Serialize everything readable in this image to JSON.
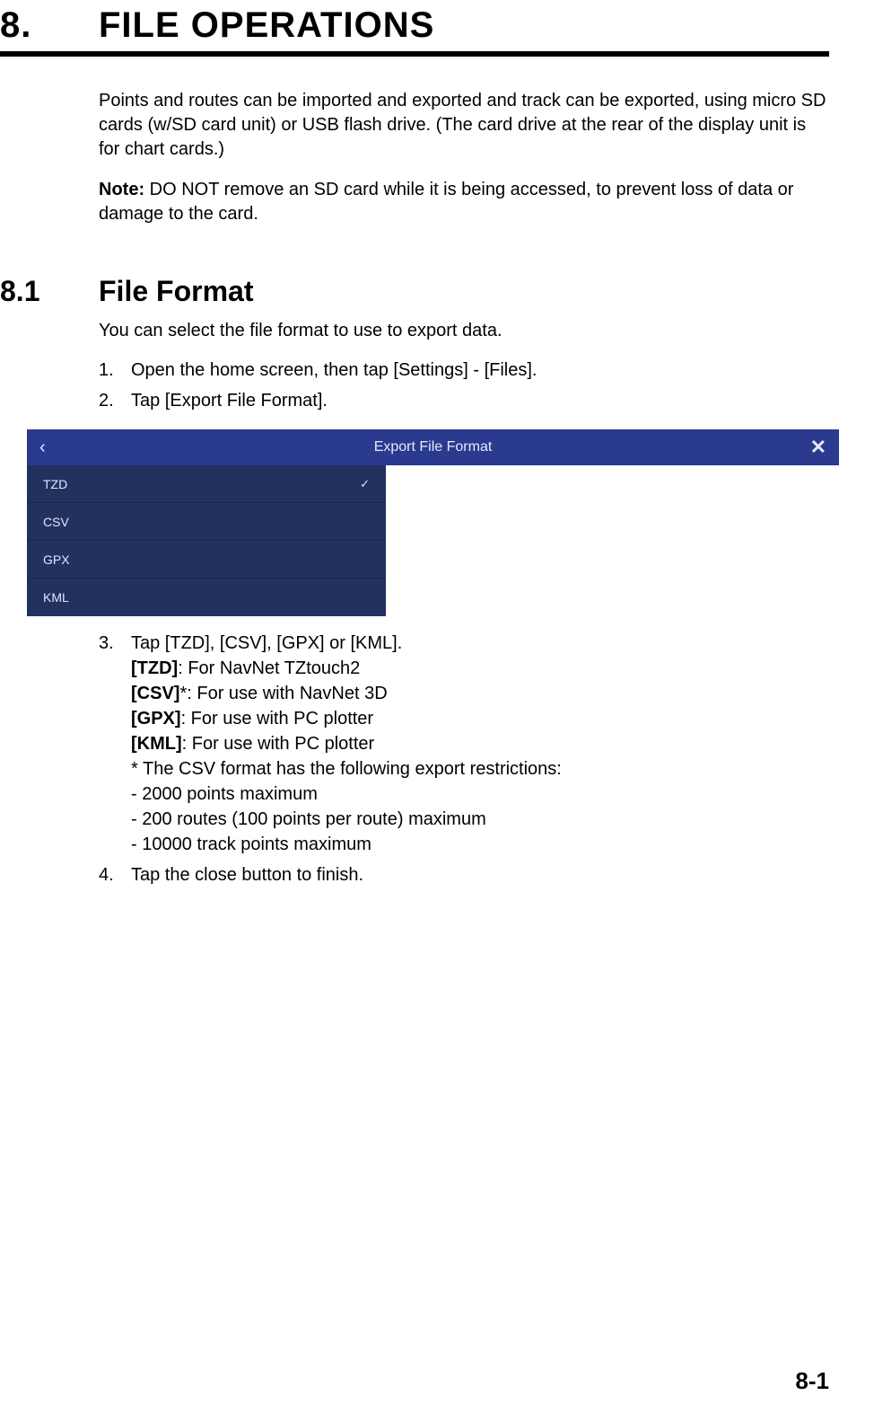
{
  "chapter": {
    "number": "8.",
    "title": "FILE OPERATIONS"
  },
  "intro": {
    "para1": "Points and routes can be imported and exported and track can be exported, using micro SD cards (w/SD card unit) or USB flash drive. (The card drive at the rear of the display unit is for chart cards.)",
    "note_label": "Note:",
    "note_text": " DO NOT remove an SD card while it is being accessed, to prevent loss of data or damage to the card."
  },
  "section": {
    "number": "8.1",
    "title": "File Format",
    "intro": "You can select the file format to use to export data.",
    "steps": {
      "s1": {
        "num": "1.",
        "text": "Open the home screen, then tap [Settings] - [Files]."
      },
      "s2": {
        "num": "2.",
        "text": "Tap [Export File Format]."
      },
      "s3": {
        "num": "3.",
        "text_intro": "Tap [TZD], [CSV], [GPX] or [KML].",
        "tzd_label": "[TZD]",
        "tzd_desc": ": For NavNet TZtouch2",
        "csv_label": "[CSV]",
        "csv_desc": "*: For use with NavNet 3D",
        "gpx_label": "[GPX]",
        "gpx_desc": ": For use with PC plotter",
        "kml_label": "[KML]",
        "kml_desc": ": For use with PC plotter",
        "csv_note_intro": "* The CSV format has the following export restrictions:",
        "csv_note_1": "- 2000 points maximum",
        "csv_note_2": "- 200 routes (100 points per route) maximum",
        "csv_note_3": "- 10000 track points maximum"
      },
      "s4": {
        "num": "4.",
        "text": "Tap the close button to finish."
      }
    }
  },
  "ui": {
    "title": "Export File Format",
    "items": {
      "tzd": "TZD",
      "csv": "CSV",
      "gpx": "GPX",
      "kml": "KML"
    },
    "back_glyph": "‹",
    "close_glyph": "✕",
    "check_glyph": "✓"
  },
  "page_number": "8-1"
}
